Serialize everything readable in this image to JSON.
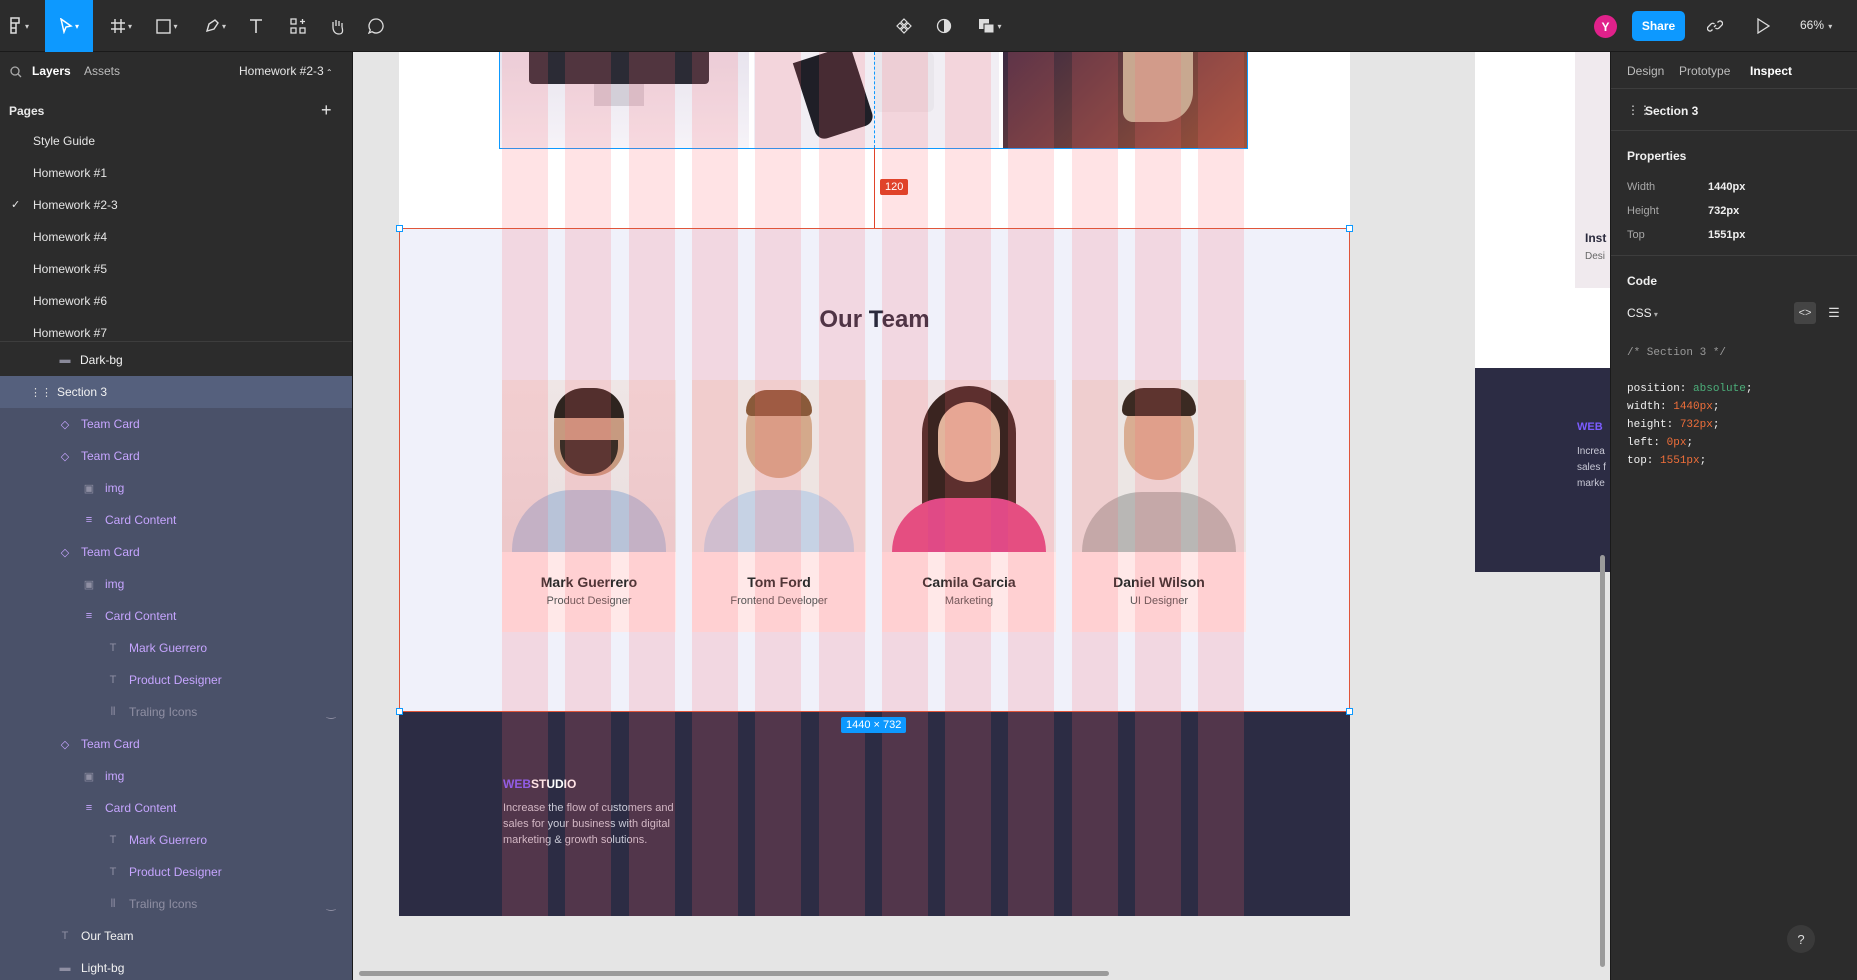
{
  "toolbar": {
    "zoom": "66%",
    "avatar_initial": "Y",
    "share_label": "Share"
  },
  "left_panel": {
    "tabs": {
      "layers": "Layers",
      "assets": "Assets"
    },
    "current_page": "Homework #2-3",
    "pages_heading": "Pages",
    "pages": [
      "Style Guide",
      "Homework #1",
      "Homework #2-3",
      "Homework #4",
      "Homework #5",
      "Homework #6",
      "Homework #7"
    ],
    "layers": [
      {
        "label": "Dark-bg",
        "icon": "rectangle-icon"
      },
      {
        "label": "Section 3",
        "icon": "frame-icon"
      },
      {
        "label": "Team Card",
        "icon": "component-instance-icon"
      },
      {
        "label": "Team Card",
        "icon": "component-instance-icon"
      },
      {
        "label": "img",
        "icon": "image-icon"
      },
      {
        "label": "Card Content",
        "icon": "auto-layout-icon"
      },
      {
        "label": "Team Card",
        "icon": "component-instance-icon"
      },
      {
        "label": "img",
        "icon": "image-icon"
      },
      {
        "label": "Card Content",
        "icon": "auto-layout-icon"
      },
      {
        "label": "Mark Guerrero",
        "icon": "text-icon"
      },
      {
        "label": "Product Designer",
        "icon": "text-icon"
      },
      {
        "label": "Traling Icons",
        "icon": "auto-layout-horizontal-icon"
      },
      {
        "label": "Team Card",
        "icon": "component-instance-icon"
      },
      {
        "label": "img",
        "icon": "image-icon"
      },
      {
        "label": "Card Content",
        "icon": "auto-layout-icon"
      },
      {
        "label": "Mark Guerrero",
        "icon": "text-icon"
      },
      {
        "label": "Product Designer",
        "icon": "text-icon"
      },
      {
        "label": "Traling Icons",
        "icon": "auto-layout-horizontal-icon"
      },
      {
        "label": "Our Team",
        "icon": "text-icon"
      },
      {
        "label": "Light-bg",
        "icon": "rectangle-icon"
      }
    ]
  },
  "canvas": {
    "section_heading": "Our Team",
    "gap_measure": "120",
    "selection_size": "1440 × 732",
    "team": [
      {
        "name": "Mark Guerrero",
        "role": "Product Designer"
      },
      {
        "name": "Tom Ford",
        "role": "Frontend Developer"
      },
      {
        "name": "Camila Garcia",
        "role": "Marketing"
      },
      {
        "name": "Daniel Wilson",
        "role": "UI Designer"
      }
    ],
    "footer": {
      "brand_accent": "WEB",
      "brand_rest": "STUDIO",
      "tagline": "Increase the flow of customers and sales for your business with digital marketing & growth solutions."
    },
    "right_frame_snippets": {
      "heading": "Inst",
      "subtext": "Desi",
      "brand_partial": "WEB",
      "text_lines": [
        "Increa",
        "sales f",
        "marke"
      ]
    }
  },
  "right_panel": {
    "tabs": {
      "design": "Design",
      "prototype": "Prototype",
      "inspect": "Inspect"
    },
    "layer_name": "Section 3",
    "properties_heading": "Properties",
    "properties": [
      {
        "key": "Width",
        "value": "1440px"
      },
      {
        "key": "Height",
        "value": "732px"
      },
      {
        "key": "Top",
        "value": "1551px"
      }
    ],
    "code_heading": "Code",
    "code_lang": "CSS",
    "code": {
      "comment": "/* Section 3 */",
      "lines": [
        {
          "prop": "position:",
          "value": "absolute",
          "kind": "str"
        },
        {
          "prop": "width:",
          "value": "1440px",
          "kind": "num"
        },
        {
          "prop": "height:",
          "value": "732px",
          "kind": "num"
        },
        {
          "prop": "left:",
          "value": "0px",
          "kind": "num"
        },
        {
          "prop": "top:",
          "value": "1551px",
          "kind": "num"
        }
      ]
    },
    "help": "?"
  },
  "colors": {
    "accent": "#0d99ff",
    "measure": "#e0432a",
    "footer_bg": "#2c2c44",
    "brand_purple": "#7b5cff"
  }
}
